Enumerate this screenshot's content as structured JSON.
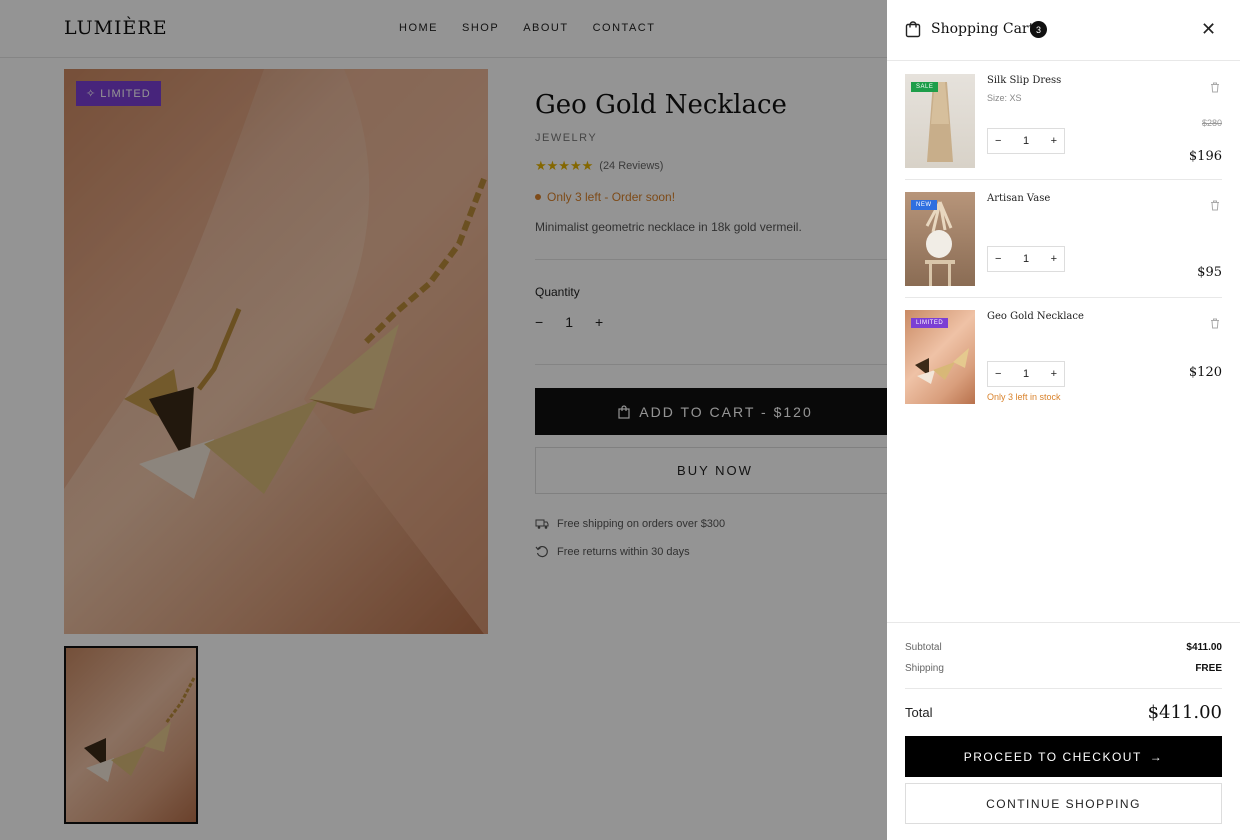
{
  "store": {
    "logo": "LUMIÈRE",
    "nav": [
      "HOME",
      "SHOP",
      "ABOUT",
      "CONTACT"
    ]
  },
  "product": {
    "badge": "LIMITED",
    "title": "Geo Gold Necklace",
    "category": "JEWELRY",
    "stars": "★★★★★",
    "reviews": "(24 Reviews)",
    "stock_alert": "Only 3 left - Order soon!",
    "description": "Minimalist geometric necklace in 18k gold vermeil.",
    "quantity_label": "Quantity",
    "quantity": "1",
    "add_to_cart": "ADD TO CART - $120",
    "buy_now": "BUY NOW",
    "perks": [
      "Free shipping on orders over $300",
      "Free returns within 30 days"
    ]
  },
  "cart": {
    "title": "Shopping Cart",
    "count": "3",
    "items": [
      {
        "name": "Silk Slip Dress",
        "size": "Size: XS",
        "tag": "SALE",
        "tag_color": "#1e9e4a",
        "qty": "1",
        "old_price": "$280",
        "price": "$196"
      },
      {
        "name": "Artisan Vase",
        "tag": "NEW",
        "tag_color": "#2f6fe0",
        "qty": "1",
        "price": "$95"
      },
      {
        "name": "Geo Gold Necklace",
        "tag": "LIMITED",
        "tag_color": "#7b3fd4",
        "qty": "1",
        "price": "$120",
        "warning": "Only 3 left in stock"
      }
    ],
    "subtotal_label": "Subtotal",
    "subtotal": "$411.00",
    "shipping_label": "Shipping",
    "shipping": "FREE",
    "total_label": "Total",
    "total": "$411.00",
    "checkout": "PROCEED TO CHECKOUT",
    "continue": "CONTINUE SHOPPING"
  }
}
